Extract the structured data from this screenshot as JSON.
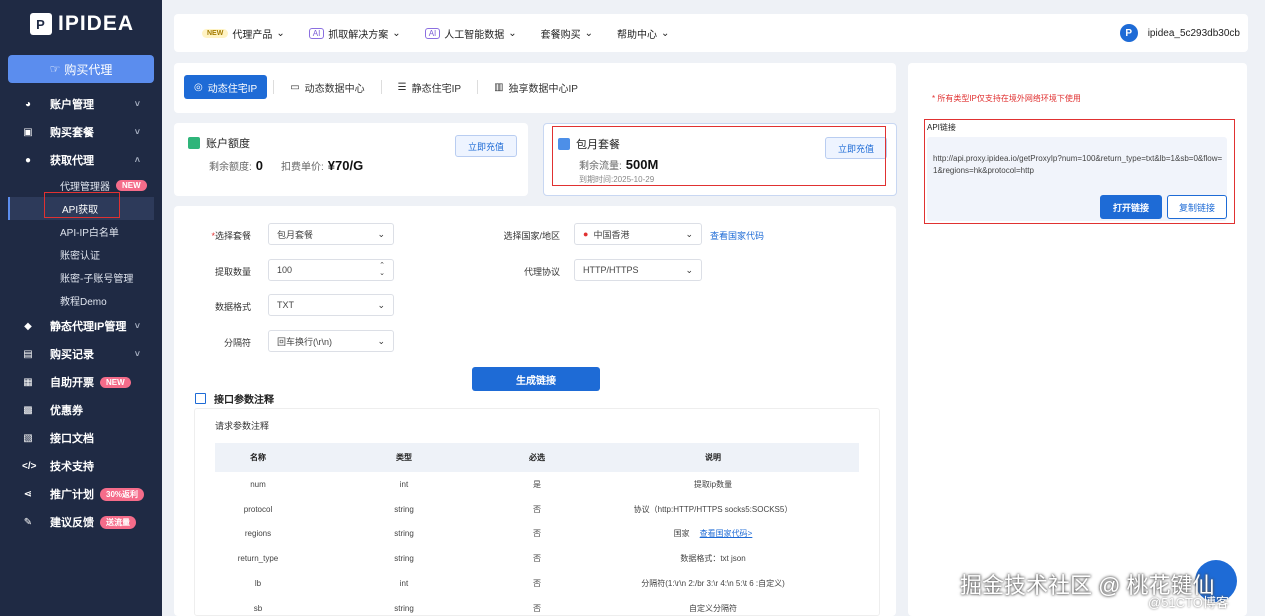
{
  "app": {
    "logo_text": "IPIDEA",
    "logo_mark": "P"
  },
  "sidebar": {
    "buy_label": "购买代理",
    "items": [
      {
        "label": "账户管理",
        "icon": "pie-chart-icon",
        "chev": "˅"
      },
      {
        "label": "购买套餐",
        "icon": "bag-icon",
        "chev": "˅"
      },
      {
        "label": "获取代理",
        "icon": "user-icon",
        "chev": "˄"
      }
    ],
    "sub_items": [
      {
        "label": "代理管理器",
        "badge": "NEW"
      },
      {
        "label": "API获取"
      },
      {
        "label": "API-IP白名单"
      },
      {
        "label": "账密认证"
      },
      {
        "label": "账密-子账号管理"
      },
      {
        "label": "教程Demo"
      }
    ],
    "items2": [
      {
        "label": "静态代理IP管理",
        "icon": "server-icon",
        "chev": "˅"
      },
      {
        "label": "购买记录",
        "icon": "record-icon",
        "chev": "˅"
      },
      {
        "label": "自助开票",
        "icon": "invoice-icon",
        "badge": "NEW"
      },
      {
        "label": "优惠券",
        "icon": "coupon-icon"
      },
      {
        "label": "接口文档",
        "icon": "doc-icon"
      },
      {
        "label": "技术支持",
        "icon": "code-icon"
      },
      {
        "label": "推广计划",
        "icon": "share-icon",
        "badge": "30%返利"
      },
      {
        "label": "建议反馈",
        "icon": "feedback-icon",
        "badge": "送流量"
      }
    ]
  },
  "topbar": {
    "nav": [
      {
        "tag": "NEW",
        "label": "代理产品"
      },
      {
        "tag": "AI",
        "label": "抓取解决方案"
      },
      {
        "tag": "AI",
        "label": "人工智能数据"
      },
      {
        "label": "套餐购买"
      },
      {
        "label": "帮助中心"
      }
    ],
    "username": "ipidea_5c293db30cb"
  },
  "tabs": [
    "动态住宅IP",
    "动态数据中心",
    "静态住宅IP",
    "独享数据中心IP"
  ],
  "balance_card": {
    "title": "账户额度",
    "remain_label": "剩余额度:",
    "remain_value": "0",
    "price_label": "扣费单价:",
    "price_value": "¥70/G",
    "button": "立即充值"
  },
  "package_card": {
    "title": "包月套餐",
    "traffic_label": "剩余流量:",
    "traffic_value": "500M",
    "expire_text": "到期时间:2025-10-29",
    "button": "立即充值"
  },
  "form": {
    "package_label": "选择套餐",
    "package_value": "包月套餐",
    "country_label": "选择国家/地区",
    "country_value": "中国香港",
    "country_link": "查看国家代码",
    "qty_label": "提取数量",
    "qty_value": "100",
    "protocol_label": "代理协议",
    "protocol_value": "HTTP/HTTPS",
    "format_label": "数据格式",
    "format_value": "TXT",
    "sep_label": "分隔符",
    "sep_value": "回车换行(\\r\\n)",
    "generate_button": "生成链接"
  },
  "params": {
    "section_title": "接口参数注释",
    "sub_title": "请求参数注释",
    "headers": [
      "名称",
      "类型",
      "必选",
      "说明"
    ],
    "rows": [
      {
        "name": "num",
        "type": "int",
        "required": "是",
        "desc": "提取ip数量"
      },
      {
        "name": "protocol",
        "type": "string",
        "required": "否",
        "desc": "协议（http:HTTP/HTTPS socks5:SOCKS5）"
      },
      {
        "name": "regions",
        "type": "string",
        "required": "否",
        "desc": "国家",
        "link": "查看国家代码>"
      },
      {
        "name": "return_type",
        "type": "string",
        "required": "否",
        "desc": "数据格式：txt json"
      },
      {
        "name": "lb",
        "type": "int",
        "required": "否",
        "desc": "分隔符(1:\\r\\n 2:/br 3:\\r 4:\\n 5:\\t 6 :自定义)"
      },
      {
        "name": "sb",
        "type": "string",
        "required": "否",
        "desc": "自定义分隔符"
      }
    ]
  },
  "api_panel": {
    "note": "* 所有类型IP仅支持在境外网络环境下使用",
    "label": "API链接",
    "url": "http://api.proxy.ipidea.io/getProxyIp?num=100&return_type=txt&lb=1&sb=0&flow=1&regions=hk&protocol=http",
    "open_button": "打开链接",
    "copy_button": "复制链接"
  },
  "watermark": {
    "text": "掘金技术社区 @ 桃花键仙",
    "sub": "@51CTO博客"
  }
}
